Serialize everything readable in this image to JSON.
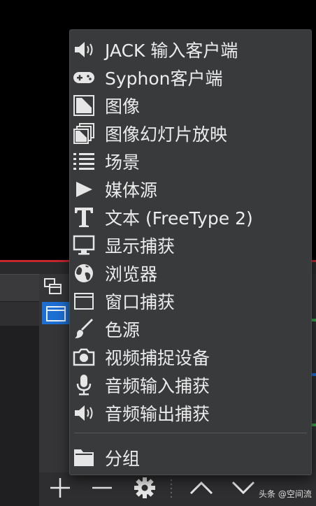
{
  "menu": {
    "items": [
      {
        "label": "JACK 输入客户端",
        "icon": "speaker-icon"
      },
      {
        "label": "Syphon客户端",
        "icon": "gamepad-icon"
      },
      {
        "label": "图像",
        "icon": "image-icon"
      },
      {
        "label": "图像幻灯片放映",
        "icon": "slideshow-icon"
      },
      {
        "label": "场景",
        "icon": "list-icon"
      },
      {
        "label": "媒体源",
        "icon": "play-icon"
      },
      {
        "label": "文本 (FreeType 2)",
        "icon": "text-icon"
      },
      {
        "label": "显示捕获",
        "icon": "monitor-icon"
      },
      {
        "label": "浏览器",
        "icon": "globe-icon"
      },
      {
        "label": "窗口捕获",
        "icon": "window-icon"
      },
      {
        "label": "色源",
        "icon": "brush-icon"
      },
      {
        "label": "视频捕捉设备",
        "icon": "camera-icon"
      },
      {
        "label": "音频输入捕获",
        "icon": "microphone-icon"
      },
      {
        "label": "音频输出捕获",
        "icon": "speaker-icon"
      }
    ],
    "group": {
      "label": "分组",
      "icon": "folder-icon"
    }
  },
  "toolbar": {
    "add": "+",
    "remove": "−",
    "settings": "gear-icon",
    "up": "chevron-up-icon",
    "down": "chevron-down-icon"
  },
  "watermark": "头条 @空间流",
  "colors": {
    "selection": "#1d6fd1",
    "menu_bg": "#393a3c",
    "recording_line": "#c4262e"
  }
}
